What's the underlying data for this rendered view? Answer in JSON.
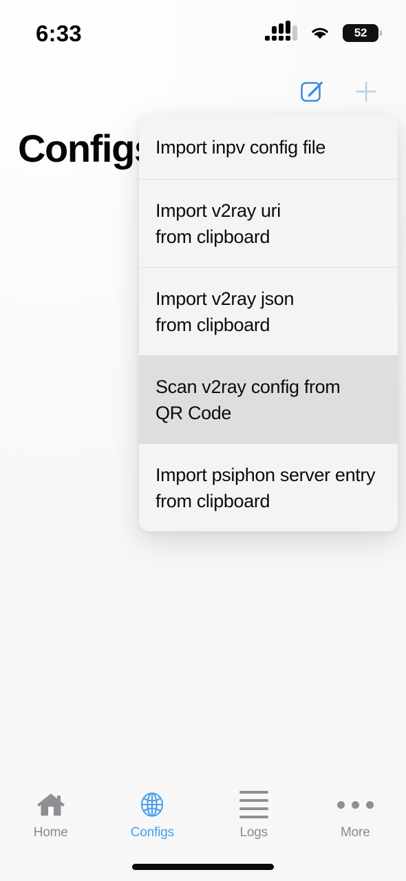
{
  "status_bar": {
    "time": "6:33",
    "cellular_icon": "cellular-signal-icon",
    "wifi_icon": "wifi-icon",
    "battery_percent": "52"
  },
  "nav_bar": {
    "compose_icon": "compose-edit-icon",
    "add_icon": "plus-icon"
  },
  "page": {
    "title": "Configs"
  },
  "context_menu": {
    "items": [
      {
        "lines": [
          "Import inpv config file"
        ],
        "highlighted": false,
        "name": "menu-item-import-inpv-config-file"
      },
      {
        "lines": [
          "Import v2ray uri",
          "from clipboard"
        ],
        "highlighted": false,
        "name": "menu-item-import-v2ray-uri"
      },
      {
        "lines": [
          "Import v2ray json",
          "from clipboard"
        ],
        "highlighted": false,
        "name": "menu-item-import-v2ray-json"
      },
      {
        "lines": [
          "Scan v2ray config from",
          "QR Code"
        ],
        "highlighted": true,
        "name": "menu-item-scan-v2ray-qr-code"
      },
      {
        "lines": [
          "Import psiphon server entry",
          "from clipboard"
        ],
        "highlighted": false,
        "name": "menu-item-import-psiphon-server-entry"
      }
    ]
  },
  "tab_bar": {
    "active_color": "#44a0ea",
    "inactive_color": "#8a8a8e",
    "tabs": [
      {
        "label": "Home",
        "icon": "house-icon",
        "active": false
      },
      {
        "label": "Configs",
        "icon": "globe-icon",
        "active": true
      },
      {
        "label": "Logs",
        "icon": "list-lines-icon",
        "active": false
      },
      {
        "label": "More",
        "icon": "ellipsis-icon",
        "active": false
      }
    ]
  }
}
